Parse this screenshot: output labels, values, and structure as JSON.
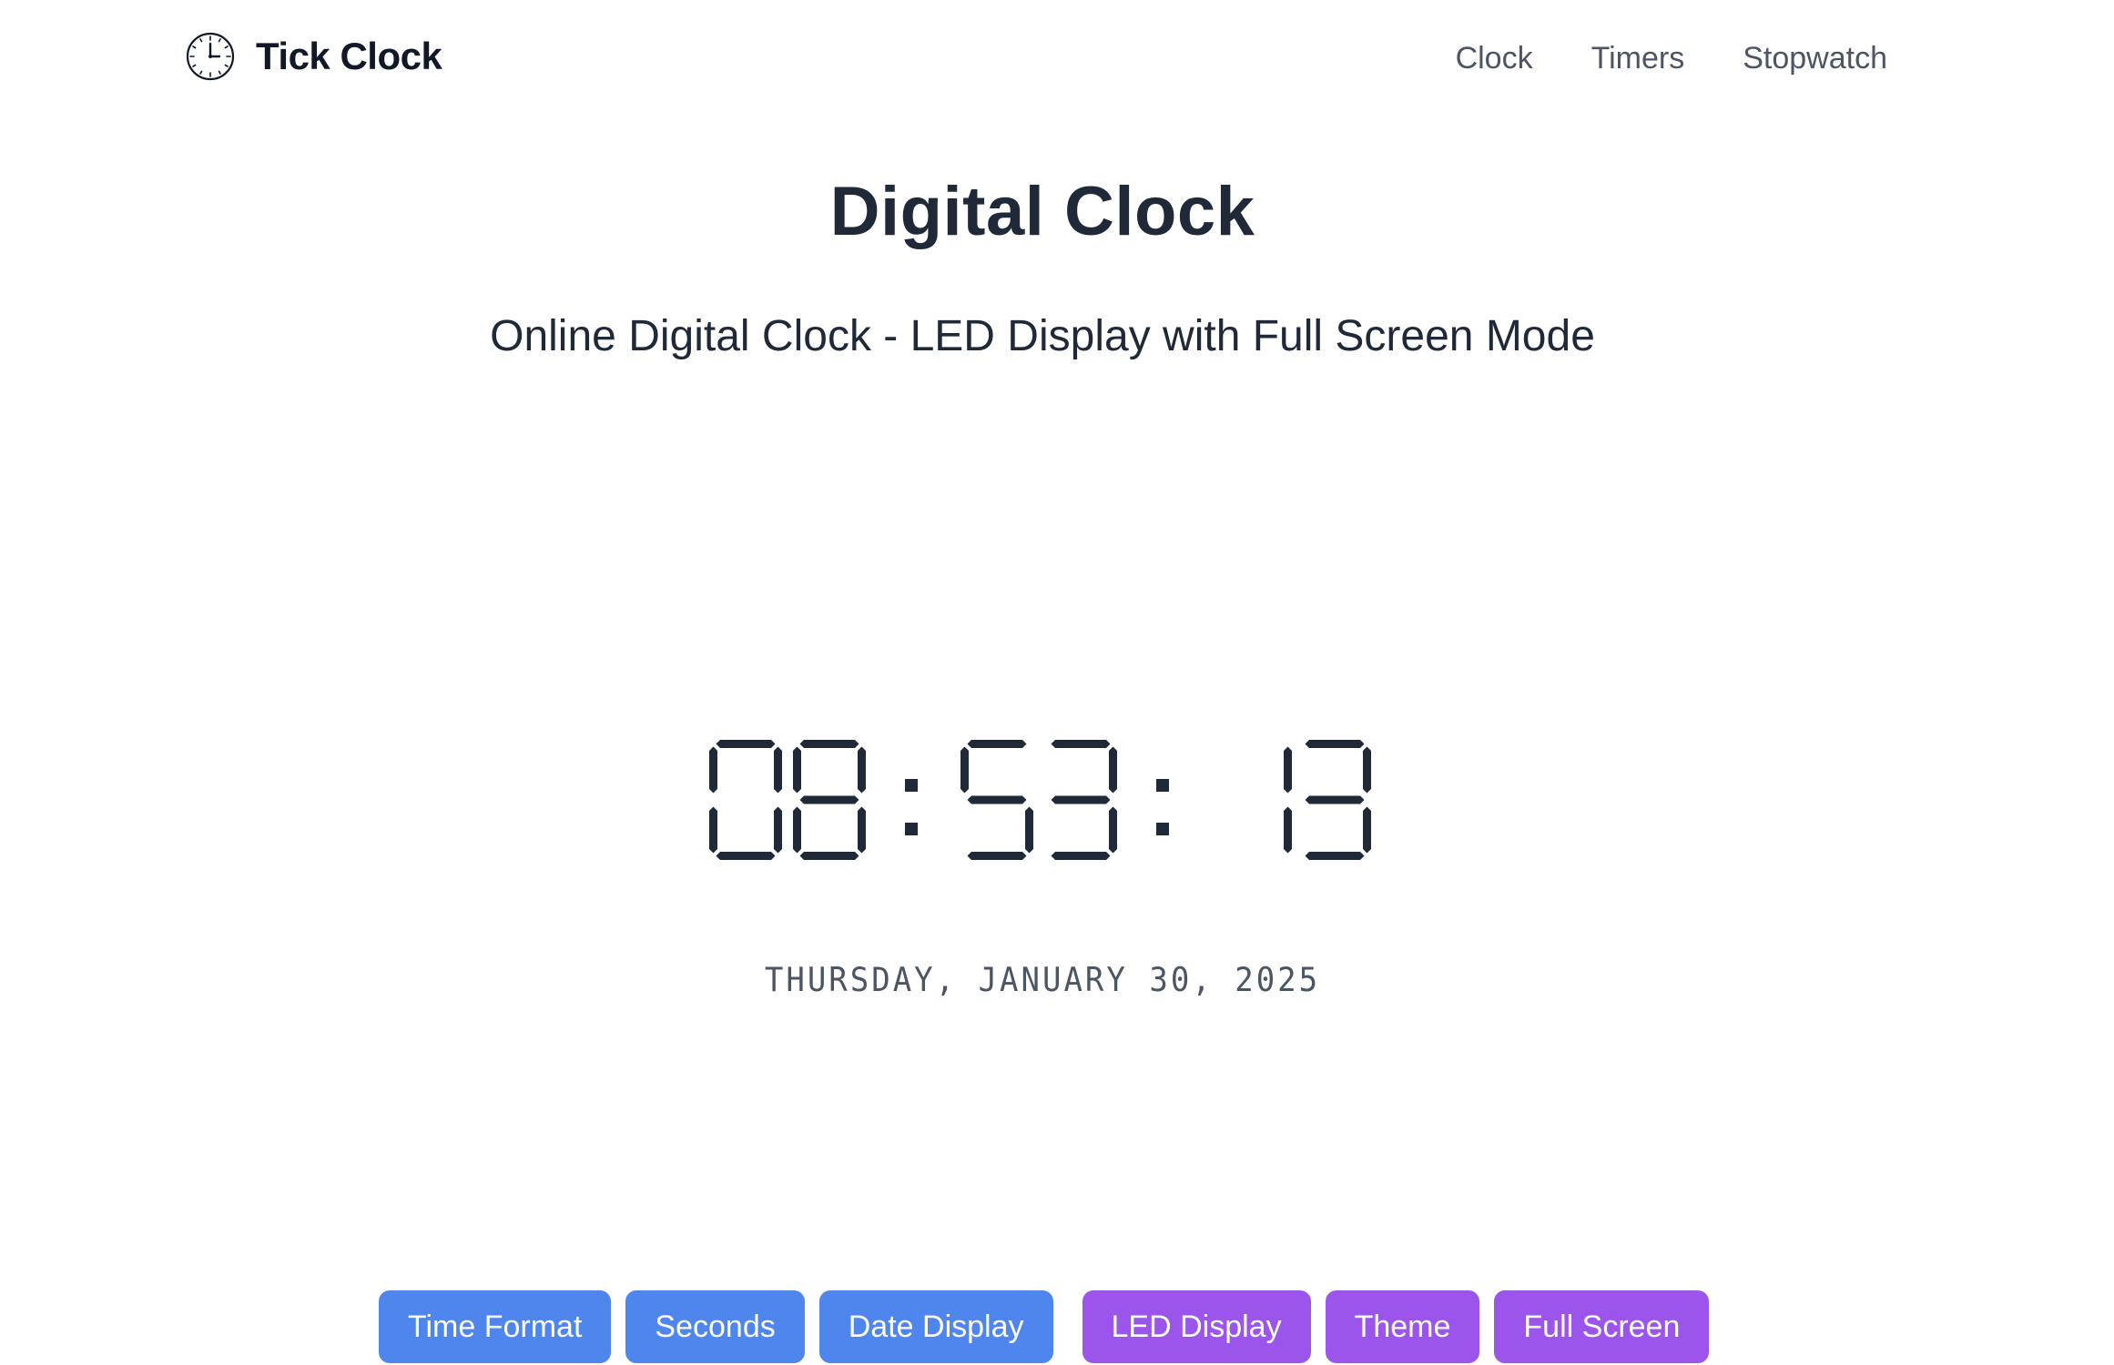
{
  "app": {
    "name": "Tick Clock",
    "icon": "clock-icon"
  },
  "nav": {
    "items": [
      "Clock",
      "Timers",
      "Stopwatch"
    ]
  },
  "main": {
    "title": "Digital Clock",
    "subtitle": "Online Digital Clock - LED Display with Full Screen Mode",
    "time": {
      "hours": "08",
      "minutes": "53",
      "seconds": "13",
      "text": "08:53: 13",
      "style": "seven-segment LED",
      "color": "#1f2937"
    },
    "date": "THURSDAY, JANUARY 30, 2025"
  },
  "controls": {
    "buttons": [
      {
        "label": "Time Format",
        "color": "#4f86ee"
      },
      {
        "label": "Seconds",
        "color": "#4f86ee"
      },
      {
        "label": "Date Display",
        "color": "#4f86ee"
      },
      {
        "label": "LED Display",
        "color": "#9b55ea"
      },
      {
        "label": "Theme",
        "color": "#9b55ea"
      },
      {
        "label": "Full Screen",
        "color": "#9b55ea"
      }
    ]
  }
}
